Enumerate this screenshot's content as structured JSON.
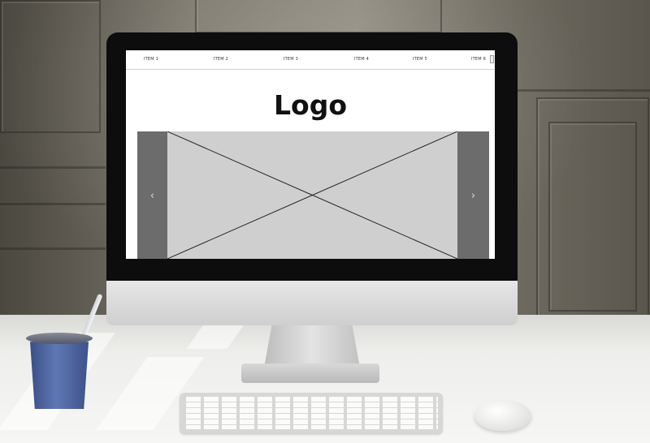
{
  "website": {
    "nav": {
      "items": [
        "ITEM 1",
        "ITEM 2",
        "ITEM 3",
        "ITEM 4",
        "ITEM 5",
        "ITEM 6"
      ]
    },
    "logo": "Logo",
    "slider": {
      "prev_icon": "chevron-left-icon",
      "next_icon": "chevron-right-icon",
      "placeholder": "image-placeholder-x"
    }
  },
  "colors": {
    "arrow_panel": "#6c6c6d",
    "image_placeholder": "#cfcfcf",
    "screen_bg": "#ffffff",
    "cup": "#4f67a3"
  }
}
